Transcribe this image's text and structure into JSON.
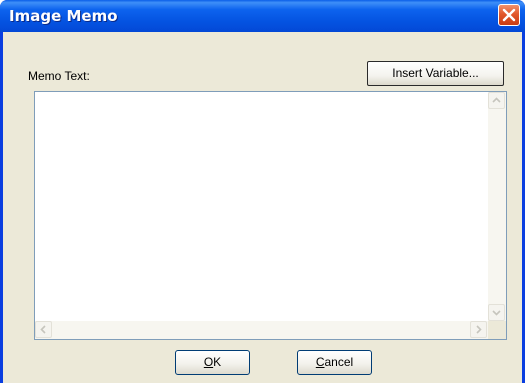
{
  "window": {
    "title": "Image Memo"
  },
  "memo": {
    "label": "Memo Text:",
    "value": ""
  },
  "insert_variable_button": {
    "label": "Insert Variable..."
  },
  "buttons": {
    "ok": {
      "accel": "O",
      "rest": "K"
    },
    "cancel": {
      "accel": "C",
      "rest": "ancel"
    }
  },
  "icons": {
    "close": "close-icon",
    "scroll_up": "arrow-up-icon",
    "scroll_down": "arrow-down-icon",
    "scroll_left": "arrow-left-icon",
    "scroll_right": "arrow-right-icon"
  },
  "colors": {
    "titlebar": "#0452e0",
    "client": "#ece9d8",
    "close_button": "#e2582c",
    "field_border": "#7f9db9"
  }
}
